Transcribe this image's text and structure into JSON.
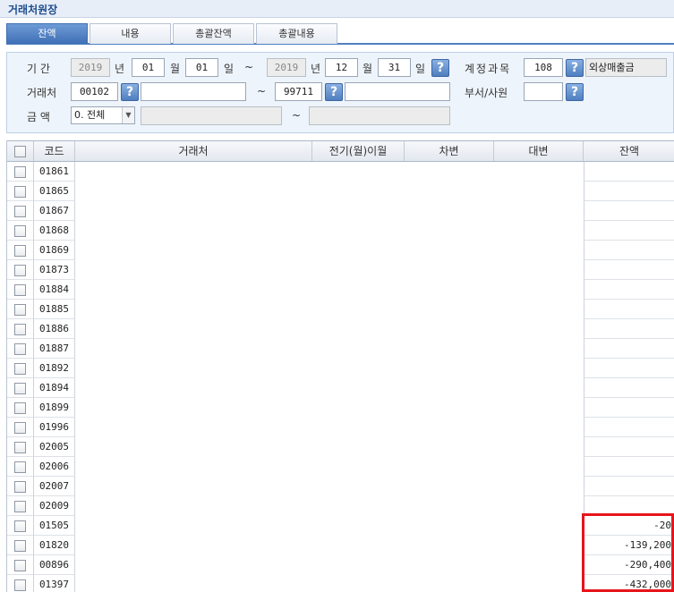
{
  "window": {
    "title": "거래처원장"
  },
  "tabs": [
    {
      "label": "잔액",
      "active": true
    },
    {
      "label": "내용",
      "active": false
    },
    {
      "label": "총괄잔액",
      "active": false
    },
    {
      "label": "총괄내용",
      "active": false
    }
  ],
  "filter": {
    "period_label": "기  간",
    "year_from": "2019",
    "year_unit": "년",
    "month_from": "01",
    "month_unit": "월",
    "day_from": "01",
    "day_unit": "일",
    "tilde": "~",
    "year_to": "2019",
    "month_to": "12",
    "day_to": "31",
    "help": "?",
    "account_label": "계정과목",
    "account_code": "108",
    "account_name": "외상매출금",
    "customer_label": "거래처",
    "customer_from_code": "00102",
    "customer_from_name": "",
    "customer_to_code": "99711",
    "customer_to_name": "",
    "dept_label": "부서/사원",
    "dept_code": "",
    "amount_label": "금  액",
    "amount_option": "0. 전체",
    "amount_from": "",
    "amount_to": ""
  },
  "grid": {
    "headers": {
      "code": "코드",
      "customer": "거래처",
      "prev_carry": "전기(월)이월",
      "debit": "차변",
      "credit": "대변",
      "balance": "잔액"
    },
    "rows": [
      {
        "code": "01861",
        "balance": ""
      },
      {
        "code": "01865",
        "balance": ""
      },
      {
        "code": "01867",
        "balance": ""
      },
      {
        "code": "01868",
        "balance": ""
      },
      {
        "code": "01869",
        "balance": ""
      },
      {
        "code": "01873",
        "balance": ""
      },
      {
        "code": "01884",
        "balance": ""
      },
      {
        "code": "01885",
        "balance": ""
      },
      {
        "code": "01886",
        "balance": ""
      },
      {
        "code": "01887",
        "balance": ""
      },
      {
        "code": "01892",
        "balance": ""
      },
      {
        "code": "01894",
        "balance": ""
      },
      {
        "code": "01899",
        "balance": ""
      },
      {
        "code": "01996",
        "balance": ""
      },
      {
        "code": "02005",
        "balance": ""
      },
      {
        "code": "02006",
        "balance": ""
      },
      {
        "code": "02007",
        "balance": ""
      },
      {
        "code": "02009",
        "balance": ""
      },
      {
        "code": "01505",
        "balance": "-20"
      },
      {
        "code": "01820",
        "balance": "-139,200"
      },
      {
        "code": "00896",
        "balance": "-290,400"
      },
      {
        "code": "01397",
        "balance": "-432,000"
      }
    ]
  },
  "colors": {
    "accent": "#3f6fb5",
    "highlight": "#e8141b"
  }
}
